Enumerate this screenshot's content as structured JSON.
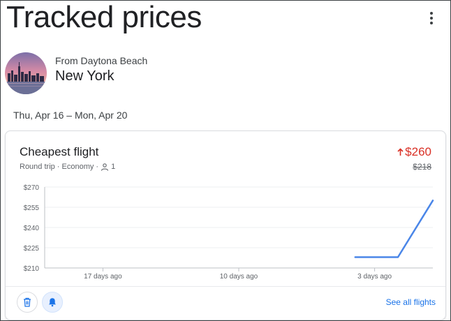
{
  "page": {
    "title": "Tracked prices"
  },
  "trip": {
    "from": "From Daytona Beach",
    "destination": "New York",
    "dates": "Thu, Apr 16 – Mon, Apr 20"
  },
  "card": {
    "title": "Cheapest flight",
    "details": "Round trip · Economy ·",
    "passengers": "1",
    "current_price": "$260",
    "price_trend": "up",
    "previous_price": "$218",
    "see_all_label": "See all flights"
  },
  "icons": {
    "more": "more-vert-icon",
    "delete": "trash-icon",
    "notifications": "bell-icon",
    "passenger": "person-icon",
    "trend": "arrow-up-icon"
  },
  "colors": {
    "price_up": "#d93025",
    "line": "#4a86e8",
    "link": "#1a73e8",
    "bell_bg": "#e8f0fe"
  },
  "chart_data": {
    "type": "line",
    "title": "",
    "xlabel": "",
    "ylabel": "",
    "ylim": [
      210,
      270
    ],
    "yticks": [
      210,
      225,
      240,
      255,
      270
    ],
    "ytick_labels": [
      "$210",
      "$225",
      "$240",
      "$255",
      "$270"
    ],
    "x_unit": "days ago",
    "xlim": [
      20,
      0
    ],
    "xticks": [
      17,
      10,
      3
    ],
    "xtick_labels": [
      "17 days ago",
      "10 days ago",
      "3 days ago"
    ],
    "grid": true,
    "series": [
      {
        "x": [
          4,
          1.8,
          0
        ],
        "values": [
          218,
          218,
          260
        ]
      }
    ]
  }
}
